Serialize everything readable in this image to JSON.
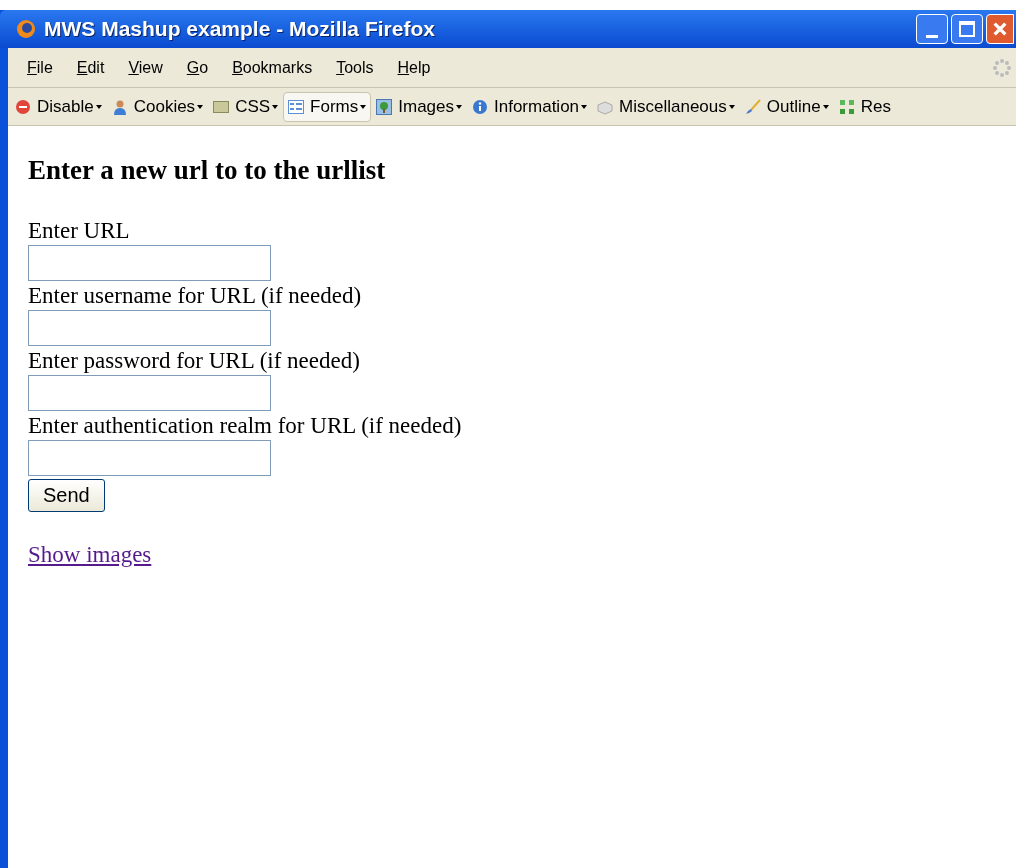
{
  "window": {
    "title": "MWS Mashup example - Mozilla Firefox"
  },
  "menu": [
    "File",
    "Edit",
    "View",
    "Go",
    "Bookmarks",
    "Tools",
    "Help"
  ],
  "toolbar": [
    {
      "label": "Disable",
      "selected": false
    },
    {
      "label": "Cookies",
      "selected": false
    },
    {
      "label": "CSS",
      "selected": false
    },
    {
      "label": "Forms",
      "selected": true
    },
    {
      "label": "Images",
      "selected": false
    },
    {
      "label": "Information",
      "selected": false
    },
    {
      "label": "Miscellaneous",
      "selected": false
    },
    {
      "label": "Outline",
      "selected": false
    },
    {
      "label": "Res",
      "selected": false
    }
  ],
  "page": {
    "heading": "Enter a new url to to the urllist",
    "fields": [
      {
        "label": "Enter URL"
      },
      {
        "label": "Enter username for URL (if needed)"
      },
      {
        "label": "Enter password for URL (if needed)"
      },
      {
        "label": "Enter authentication realm for URL (if needed)"
      }
    ],
    "button": "Send",
    "link": "Show images"
  }
}
